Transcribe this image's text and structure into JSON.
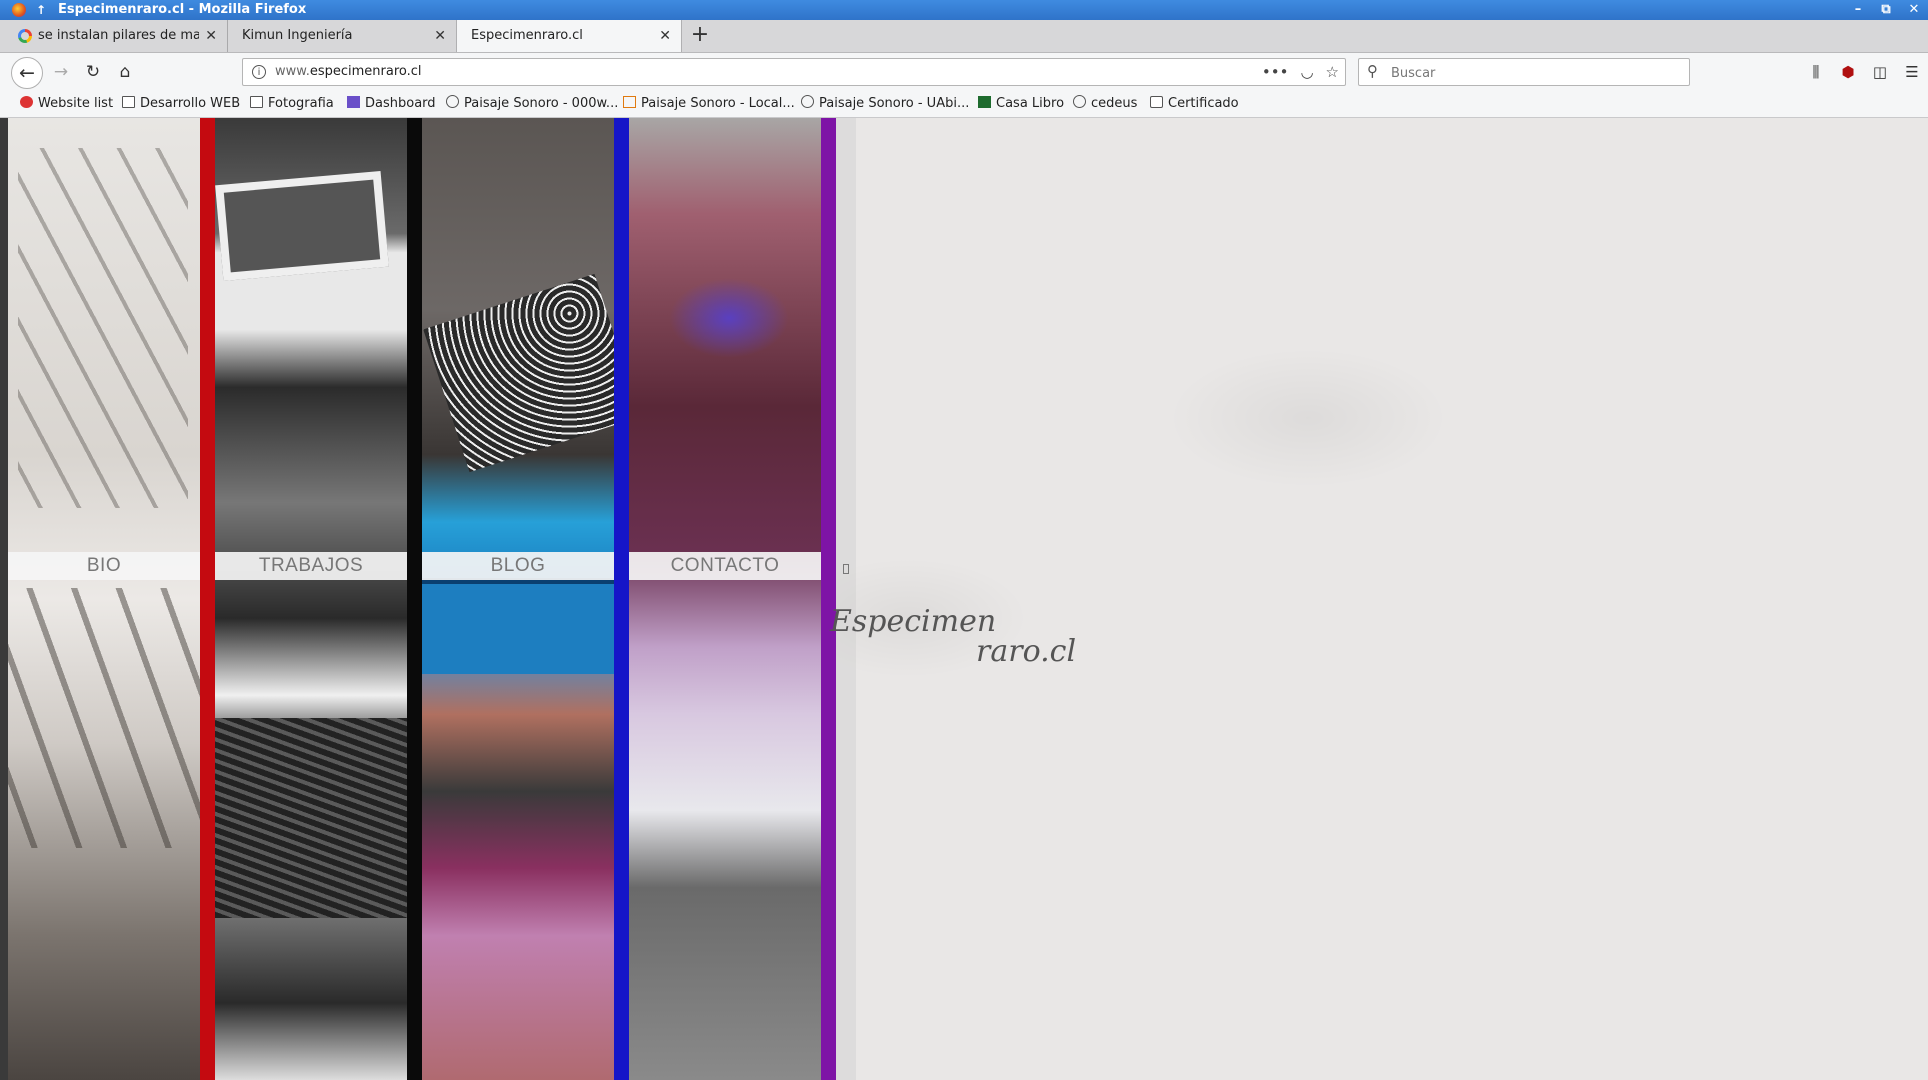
{
  "window": {
    "title": "Especimenraro.cl - Mozilla Firefox"
  },
  "tabs": [
    {
      "label": "se instalan pilares de made",
      "favicon": "google-icon"
    },
    {
      "label": "Kimun Ingeniería"
    },
    {
      "label": "Especimenraro.cl",
      "active": true
    }
  ],
  "nav": {
    "url_host": "www.",
    "url_domain": "especimenraro.cl",
    "search_placeholder": "Buscar"
  },
  "bookmarks": [
    {
      "label": "Website list",
      "icon": "website-icon"
    },
    {
      "label": "Desarrollo WEB",
      "icon": "folder-icon"
    },
    {
      "label": "Fotografia",
      "icon": "folder-icon"
    },
    {
      "label": "Dashboard",
      "icon": "dashboard-icon"
    },
    {
      "label": "Paisaje Sonoro - 000w...",
      "icon": "globe-icon"
    },
    {
      "label": "Paisaje Sonoro - Local...",
      "icon": "local-icon"
    },
    {
      "label": "Paisaje Sonoro - UAbi...",
      "icon": "globe-icon"
    },
    {
      "label": "Casa Libro",
      "icon": "book-icon"
    },
    {
      "label": "cedeus",
      "icon": "globe-icon"
    },
    {
      "label": "Certificado",
      "icon": "certificate-icon"
    }
  ],
  "site": {
    "menu": [
      {
        "label": "BIO",
        "stripe": "#c40a10"
      },
      {
        "label": "TRABAJOS",
        "stripe": "#0a0a0a"
      },
      {
        "label": "BLOG",
        "stripe": "#1515c8"
      },
      {
        "label": "CONTACTO",
        "stripe": "#7e14a6"
      }
    ],
    "logo_line1": "Especimen",
    "logo_line2": "raro.cl"
  }
}
